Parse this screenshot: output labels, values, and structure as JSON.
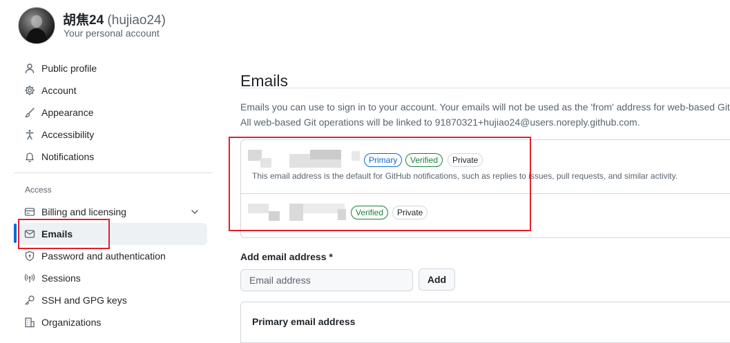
{
  "account": {
    "display_name": "胡焦24",
    "login": "(hujiao24)",
    "subtitle": "Your personal account"
  },
  "sidebar": {
    "items_top": [
      {
        "label": "Public profile",
        "icon": "person-icon"
      },
      {
        "label": "Account",
        "icon": "gear-icon"
      },
      {
        "label": "Appearance",
        "icon": "paintbrush-icon"
      },
      {
        "label": "Accessibility",
        "icon": "accessibility-icon"
      },
      {
        "label": "Notifications",
        "icon": "bell-icon"
      }
    ],
    "access_heading": "Access",
    "items_access": [
      {
        "label": "Billing and licensing",
        "icon": "credit-card-icon"
      },
      {
        "label": "Emails",
        "icon": "mail-icon",
        "active": true
      },
      {
        "label": "Password and authentication",
        "icon": "shield-lock-icon"
      },
      {
        "label": "Sessions",
        "icon": "broadcast-icon"
      },
      {
        "label": "SSH and GPG keys",
        "icon": "key-icon"
      },
      {
        "label": "Organizations",
        "icon": "organization-icon"
      }
    ]
  },
  "main": {
    "title": "Emails",
    "description_line1": "Emails you can use to sign in to your account. Your emails will not be used as the 'from' address for web-based Git o",
    "description_line2": "All web-based Git operations will be linked to 91870321+hujiao24@users.noreply.github.com.",
    "emails": [
      {
        "badges": [
          "Primary",
          "Verified",
          "Private"
        ],
        "note": "This email address is the default for GitHub notifications, such as replies to issues, pull requests, and similar activity."
      },
      {
        "badges": [
          "Verified",
          "Private"
        ]
      }
    ],
    "add_email": {
      "label": "Add email address *",
      "placeholder": "Email address",
      "button": "Add"
    },
    "primary_section_title": "Primary email address"
  },
  "colors": {
    "accent": "#0969da",
    "verified": "#1a7f37",
    "highlight": "#e0202c",
    "active_bg": "#eef1f4"
  }
}
